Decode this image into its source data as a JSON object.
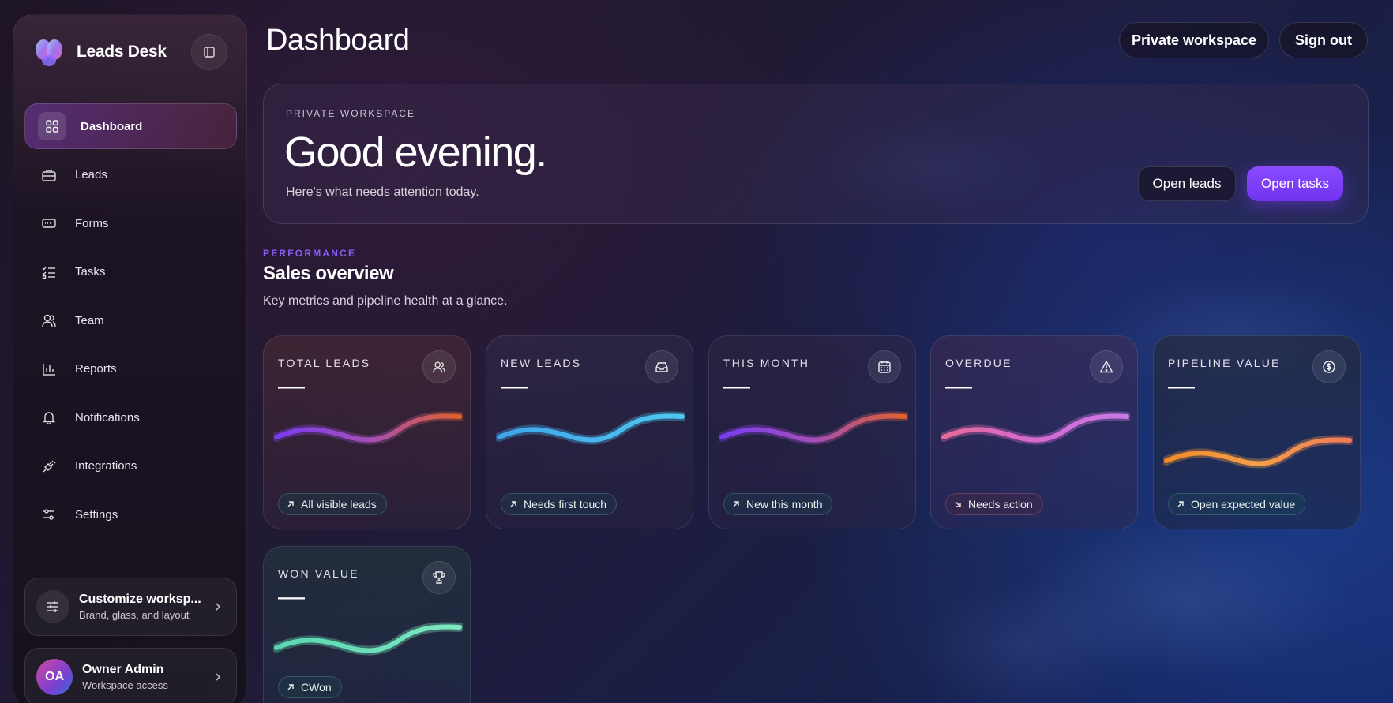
{
  "app": {
    "name": "Leads Desk"
  },
  "sidebar": {
    "items": [
      {
        "label": "Dashboard",
        "icon": "grid-icon",
        "active": true
      },
      {
        "label": "Leads",
        "icon": "briefcase-icon"
      },
      {
        "label": "Forms",
        "icon": "form-icon"
      },
      {
        "label": "Tasks",
        "icon": "checklist-icon"
      },
      {
        "label": "Team",
        "icon": "users-icon"
      },
      {
        "label": "Reports",
        "icon": "bar-chart-icon"
      },
      {
        "label": "Notifications",
        "icon": "bell-icon"
      },
      {
        "label": "Integrations",
        "icon": "plug-icon"
      },
      {
        "label": "Settings",
        "icon": "sliders-icon"
      }
    ],
    "customize": {
      "title": "Customize worksp...",
      "subtitle": "Brand, glass, and layout"
    },
    "user": {
      "initials": "OA",
      "name": "Owner Admin",
      "role": "Workspace access"
    }
  },
  "header": {
    "title": "Dashboard",
    "workspace_button": "Private workspace",
    "signout_button": "Sign out"
  },
  "hero": {
    "eyebrow": "PRIVATE WORKSPACE",
    "greeting": "Good evening.",
    "subtitle": "Here's what needs attention today.",
    "open_leads": "Open leads",
    "open_tasks": "Open tasks"
  },
  "section": {
    "eyebrow": "PERFORMANCE",
    "title": "Sales overview",
    "subtitle": "Key metrics and pipeline health at a glance."
  },
  "metrics": [
    {
      "label": "TOTAL LEADS",
      "value": "—",
      "chip": "All visible leads",
      "icon": "users-icon"
    },
    {
      "label": "NEW LEADS",
      "value": "—",
      "chip": "Needs first touch",
      "icon": "inbox-icon"
    },
    {
      "label": "THIS MONTH",
      "value": "—",
      "chip": "New this month",
      "icon": "calendar-icon"
    },
    {
      "label": "OVERDUE",
      "value": "—",
      "chip": "Needs action",
      "icon": "warning-icon"
    },
    {
      "label": "PIPELINE VALUE",
      "value": "—",
      "chip": "Open expected value",
      "icon": "dollar-icon"
    },
    {
      "label": "WON VALUE",
      "value": "—",
      "chip": "CWon",
      "icon": "trophy-icon"
    }
  ],
  "colors": {
    "accent": "#7c3aed",
    "eyebrow": "#8a5cf0"
  }
}
